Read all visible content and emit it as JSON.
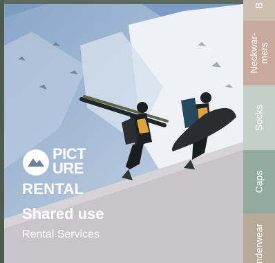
{
  "hero": {
    "logo_word_line1": "PICT",
    "logo_word_line2": "URE",
    "logo_rental": "RENTAL",
    "headline": "Shared use",
    "subhead": "Rental Services",
    "logo_icon": "picture-logo-icon",
    "image": "skiers-climbing-snow-slope-image"
  },
  "tabs": [
    {
      "label": "B",
      "color": "#cdbfb1"
    },
    {
      "label": "Neckwar-\nmers",
      "color": "#c9a99b"
    },
    {
      "label": "Socks",
      "color": "#c3cfc7"
    },
    {
      "label": "Caps",
      "color": "#93aaa0"
    },
    {
      "label": "Underwear",
      "color": "#b6a998"
    }
  ],
  "colors": {
    "text": "#ffffff",
    "sky": "#9db3cc",
    "snow": "#e8edf2",
    "foreground": "#c7c5c9"
  }
}
